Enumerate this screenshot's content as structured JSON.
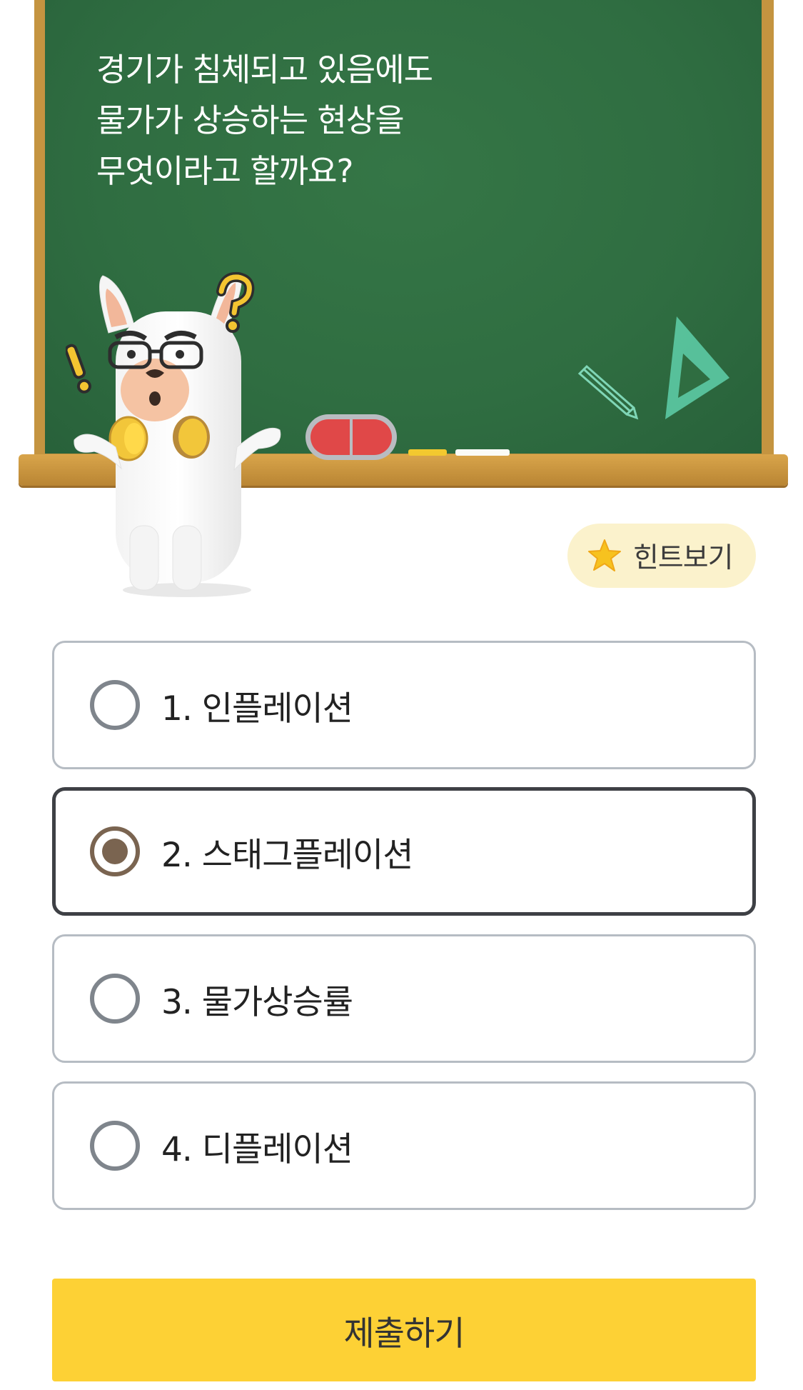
{
  "board": {
    "question": "경기가 침체되고 있음에도\n물가가 상승하는 현상을\n무엇이라고 할까요?"
  },
  "hint": {
    "label": "힌트보기",
    "icon": "star-icon"
  },
  "options": [
    {
      "label": "1. 인플레이션",
      "selected": false
    },
    {
      "label": "2. 스태그플레이션",
      "selected": true
    },
    {
      "label": "3. 물가상승률",
      "selected": false
    },
    {
      "label": "4. 디플레이션",
      "selected": false
    }
  ],
  "submit": {
    "label": "제출하기"
  },
  "colors": {
    "board": "#2f6d41",
    "frame": "#c49440",
    "accent": "#fdd135",
    "selected_radio": "#7a6450"
  }
}
